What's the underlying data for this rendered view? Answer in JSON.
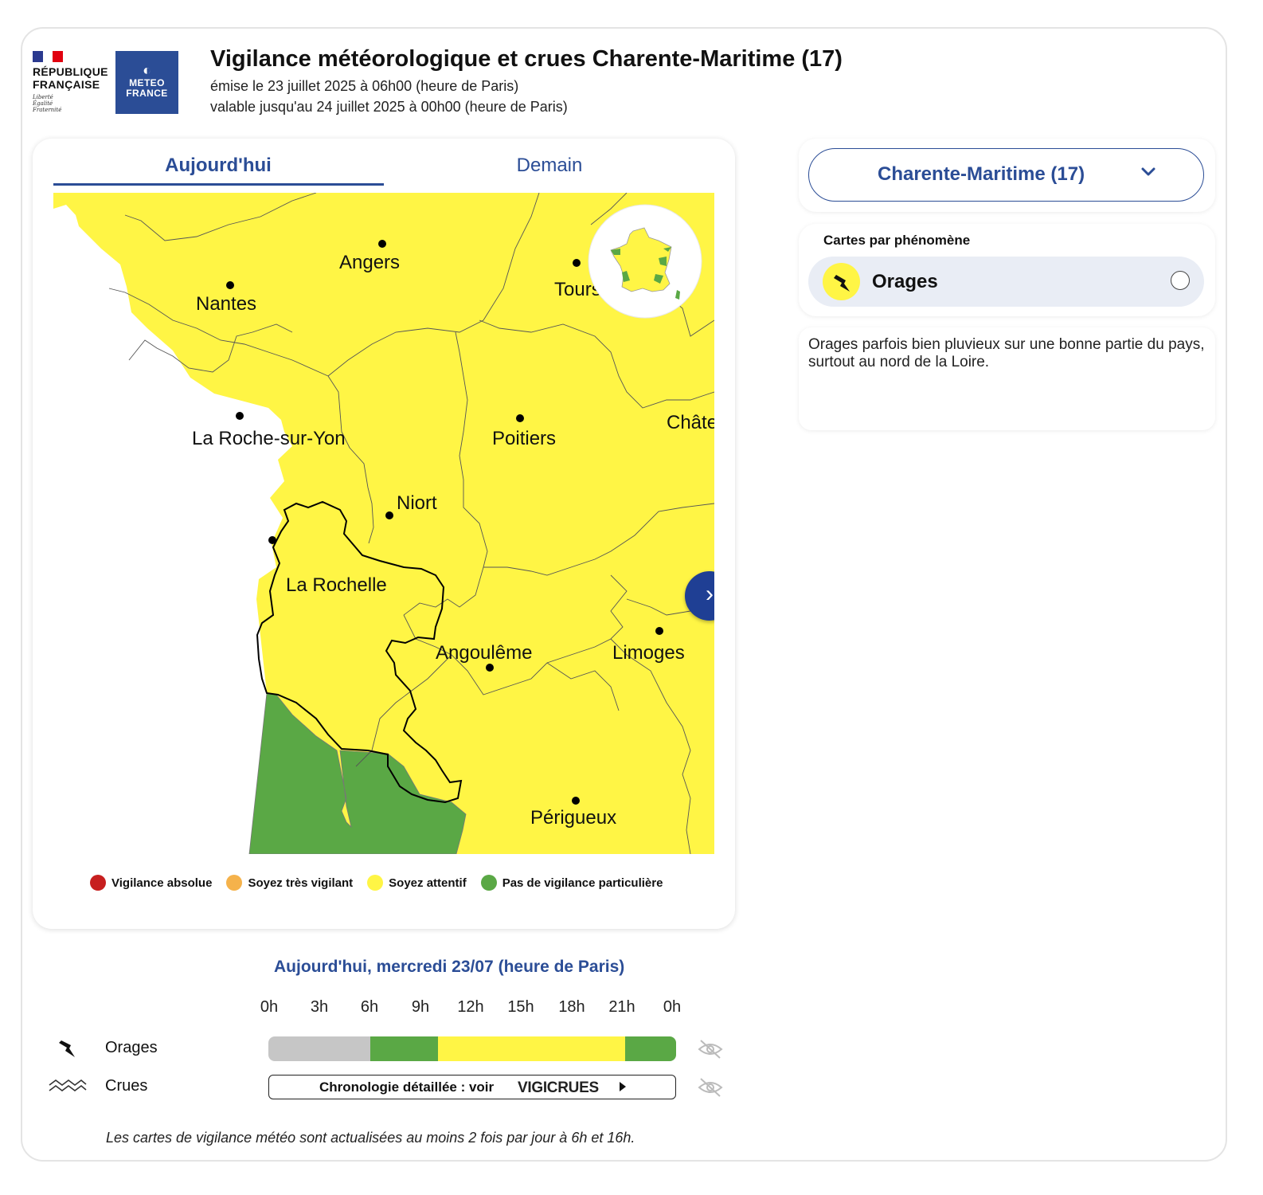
{
  "header": {
    "rf_logo_text": [
      "RÉPUBLIQUE",
      "FRANÇAISE"
    ],
    "rf_motto": [
      "Liberté",
      "Égalité",
      "Fraternité"
    ],
    "mf_logo_text": [
      "METEO",
      "FRANCE"
    ],
    "title": "Vigilance météorologique et crues Charente-Maritime (17)",
    "issued": "émise le 23 juillet 2025 à 06h00 (heure de Paris)",
    "valid": "valable jusqu'au 24 juillet 2025 à 00h00 (heure de Paris)"
  },
  "tabs": [
    {
      "label": "Aujourd'hui",
      "active": true
    },
    {
      "label": "Demain",
      "active": false
    }
  ],
  "map": {
    "cities": [
      "Angers",
      "Nantes",
      "Tours",
      "La Roche-sur-Yon",
      "Poitiers",
      "Châteauroux",
      "Niort",
      "La Rochelle",
      "Angoulême",
      "Limoges",
      "Périgueux"
    ],
    "colors": {
      "yellow": "#fff545",
      "green": "#5aa845"
    }
  },
  "legend": [
    {
      "label": "Vigilance absolue",
      "color": "#c71f1f"
    },
    {
      "label": "Soyez très vigilant",
      "color": "#f5b24b"
    },
    {
      "label": "Soyez attentif",
      "color": "#fff545"
    },
    {
      "label": "Pas de vigilance particulière",
      "color": "#5aa845"
    }
  ],
  "department_select": {
    "label": "Charente-Maritime (17)",
    "icon": "chevron-down-icon"
  },
  "phenomena": {
    "title": "Cartes par phénomène",
    "items": [
      {
        "label": "Orages",
        "icon": "lightning-icon",
        "selected": false
      }
    ]
  },
  "description": "Orages parfois bien pluvieux sur une bonne partie du pays, surtout au nord de la Loire.",
  "timeline": {
    "day_title": "Aujourd'hui, mercredi 23/07 (heure de Paris)",
    "hours": [
      "0h",
      "3h",
      "6h",
      "9h",
      "12h",
      "15h",
      "18h",
      "21h",
      "0h"
    ],
    "rows": [
      {
        "label": "Orages",
        "icon": "lightning-icon"
      },
      {
        "label": "Crues",
        "icon": "waves-icon"
      }
    ],
    "orages_segments": [
      {
        "from_h": 0,
        "to_h": 6,
        "level": "no-data",
        "color": "#c6c6c6"
      },
      {
        "from_h": 6,
        "to_h": 10,
        "level": "green",
        "color": "#5aa845"
      },
      {
        "from_h": 10,
        "to_h": 21,
        "level": "yellow",
        "color": "#fff545"
      },
      {
        "from_h": 21,
        "to_h": 24,
        "level": "green",
        "color": "#5aa845"
      }
    ],
    "crues_link_text": "Chronologie détaillée : voir",
    "crues_link_brand": "VIGICRUES"
  },
  "footnote": "Les cartes de vigilance météo sont actualisées au moins 2 fois par jour à 6h et 16h."
}
